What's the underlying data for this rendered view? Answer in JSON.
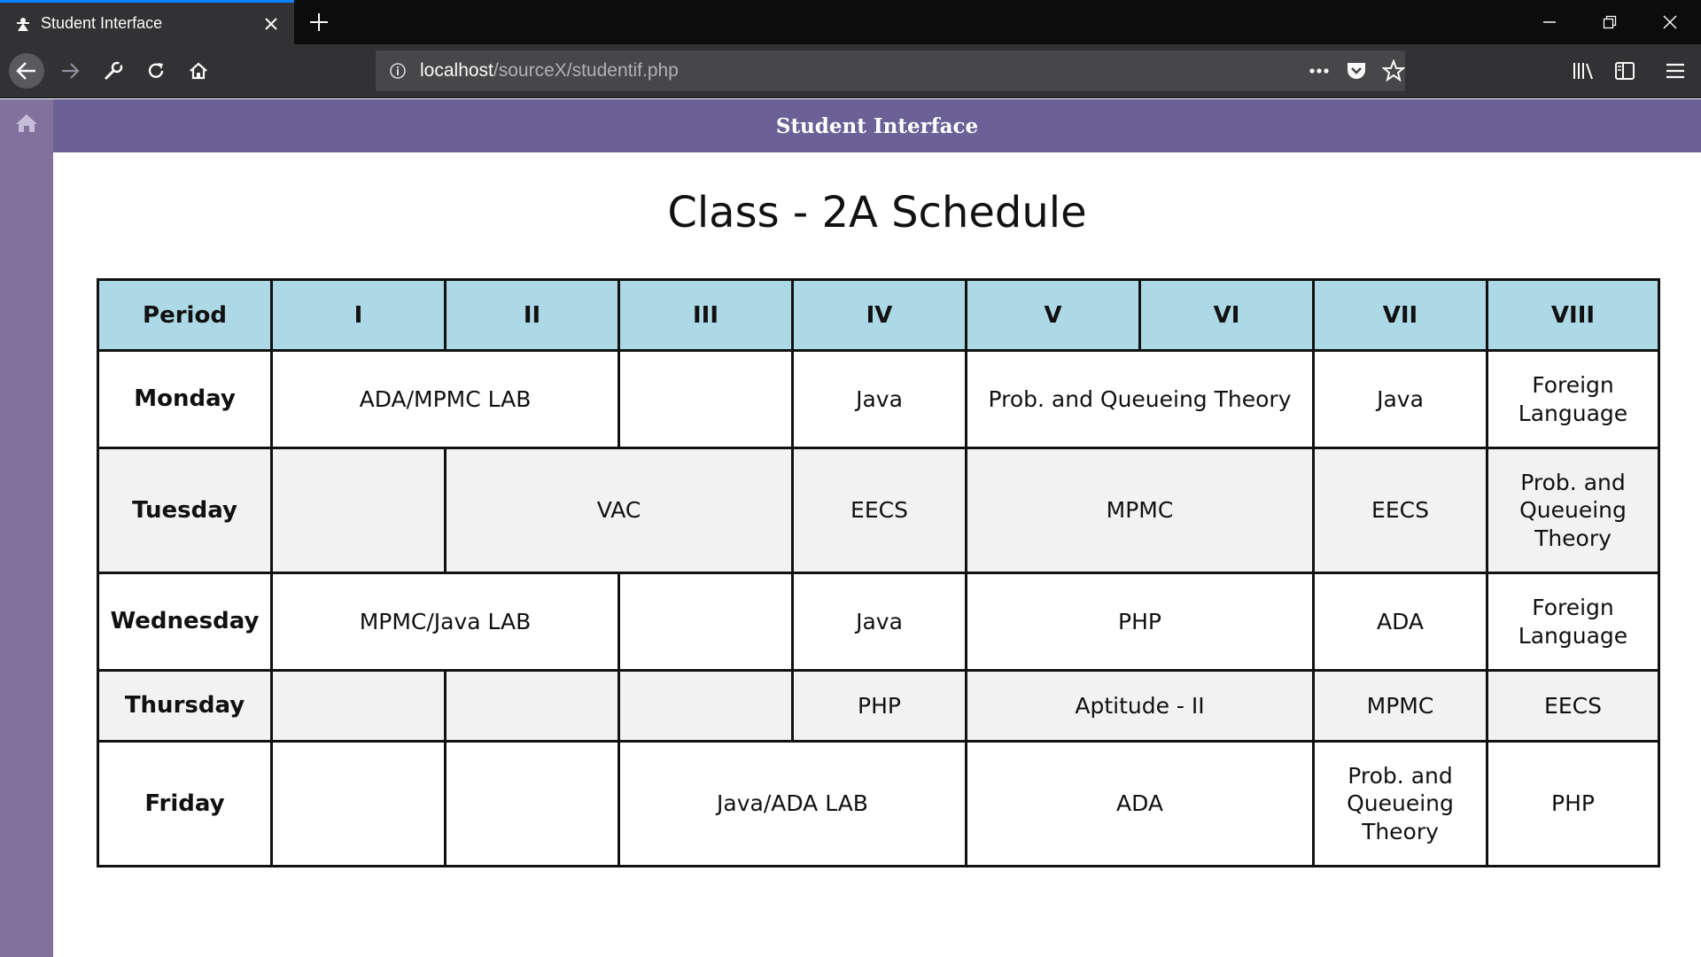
{
  "browser": {
    "tab_title": "Student Interface",
    "url_host": "localhost",
    "url_path": "/sourceX/studentif.php"
  },
  "header": {
    "title": "Student Interface"
  },
  "page": {
    "title": "Class - 2A Schedule"
  },
  "schedule": {
    "columns": [
      "Period",
      "I",
      "II",
      "III",
      "IV",
      "V",
      "VI",
      "VII",
      "VIII"
    ],
    "rows": [
      {
        "day": "Monday",
        "cells": [
          {
            "text": "ADA/MPMC LAB",
            "span": 2
          },
          {
            "text": "",
            "span": 1
          },
          {
            "text": "Java",
            "span": 1
          },
          {
            "text": "Prob. and Queueing Theory",
            "span": 2
          },
          {
            "text": "Java",
            "span": 1
          },
          {
            "text": "Foreign Language",
            "span": 1
          }
        ]
      },
      {
        "day": "Tuesday",
        "cells": [
          {
            "text": "",
            "span": 1
          },
          {
            "text": "VAC",
            "span": 2
          },
          {
            "text": "EECS",
            "span": 1
          },
          {
            "text": "MPMC",
            "span": 2
          },
          {
            "text": "EECS",
            "span": 1
          },
          {
            "text": "Prob. and Queueing Theory",
            "span": 1
          }
        ]
      },
      {
        "day": "Wednesday",
        "cells": [
          {
            "text": "MPMC/Java LAB",
            "span": 2
          },
          {
            "text": "",
            "span": 1
          },
          {
            "text": "Java",
            "span": 1
          },
          {
            "text": "PHP",
            "span": 2
          },
          {
            "text": "ADA",
            "span": 1
          },
          {
            "text": "Foreign Language",
            "span": 1
          }
        ]
      },
      {
        "day": "Thursday",
        "cells": [
          {
            "text": "",
            "span": 1
          },
          {
            "text": "",
            "span": 1
          },
          {
            "text": "",
            "span": 1
          },
          {
            "text": "PHP",
            "span": 1
          },
          {
            "text": "Aptitude - II",
            "span": 2
          },
          {
            "text": "MPMC",
            "span": 1
          },
          {
            "text": "EECS",
            "span": 1
          }
        ]
      },
      {
        "day": "Friday",
        "cells": [
          {
            "text": "",
            "span": 1
          },
          {
            "text": "",
            "span": 1
          },
          {
            "text": "Java/ADA LAB",
            "span": 2
          },
          {
            "text": "ADA",
            "span": 2
          },
          {
            "text": "Prob. and Queueing Theory",
            "span": 1
          },
          {
            "text": "PHP",
            "span": 1
          }
        ]
      }
    ]
  },
  "colors": {
    "header_bg": "#6b6196",
    "sidebar_bg": "#80729d",
    "table_header_bg": "#add8e6",
    "alt_row_bg": "#f2f2f2"
  }
}
